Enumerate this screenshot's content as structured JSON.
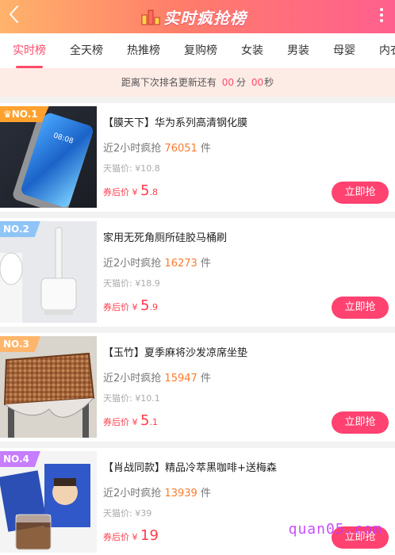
{
  "header": {
    "title": "实时疯抢榜",
    "colors": {
      "gradient_start": "#ffb36b",
      "gradient_end": "#ff5f8e"
    }
  },
  "tabs": [
    {
      "label": "实时榜",
      "active": true
    },
    {
      "label": "全天榜",
      "active": false
    },
    {
      "label": "热推榜",
      "active": false
    },
    {
      "label": "复购榜",
      "active": false
    },
    {
      "label": "女装",
      "active": false
    },
    {
      "label": "男装",
      "active": false
    },
    {
      "label": "母婴",
      "active": false
    },
    {
      "label": "内衣",
      "active": false
    }
  ],
  "countdown": {
    "prefix": "距离下次排名更新还有",
    "minutes": "00",
    "minutes_unit": "分",
    "seconds": "00",
    "seconds_unit": "秒"
  },
  "items": [
    {
      "rank": "NO.1",
      "name": "【膜天下】华为系列高清钢化膜",
      "sales_prefix": "近2小时疯抢",
      "sales_count": "76051",
      "sales_unit": "件",
      "tmall_price": "天猫价: ¥10.8",
      "coupon_label": "券后价 ¥",
      "price_int": "5",
      "price_dec": ".8",
      "buy_label": "立即抢"
    },
    {
      "rank": "NO.2",
      "name": "家用无死角厕所硅胶马桶刷",
      "sales_prefix": "近2小时疯抢",
      "sales_count": "16273",
      "sales_unit": "件",
      "tmall_price": "天猫价: ¥18.9",
      "coupon_label": "券后价 ¥",
      "price_int": "5",
      "price_dec": ".9",
      "buy_label": "立即抢"
    },
    {
      "rank": "NO.3",
      "name": "【玉竹】夏季麻将沙发凉席坐垫",
      "sales_prefix": "近2小时疯抢",
      "sales_count": "15947",
      "sales_unit": "件",
      "tmall_price": "天猫价: ¥10.1",
      "coupon_label": "券后价 ¥",
      "price_int": "5",
      "price_dec": ".1",
      "buy_label": "立即抢"
    },
    {
      "rank": "NO.4",
      "name": "【肖战同款】精品冷萃黑咖啡+送梅森",
      "sales_prefix": "近2小时疯抢",
      "sales_count": "13939",
      "sales_unit": "件",
      "tmall_price": "天猫价: ¥39",
      "coupon_label": "券后价 ¥",
      "price_int": "19",
      "price_dec": "",
      "buy_label": "立即抢"
    }
  ],
  "watermark": "quan05.com"
}
